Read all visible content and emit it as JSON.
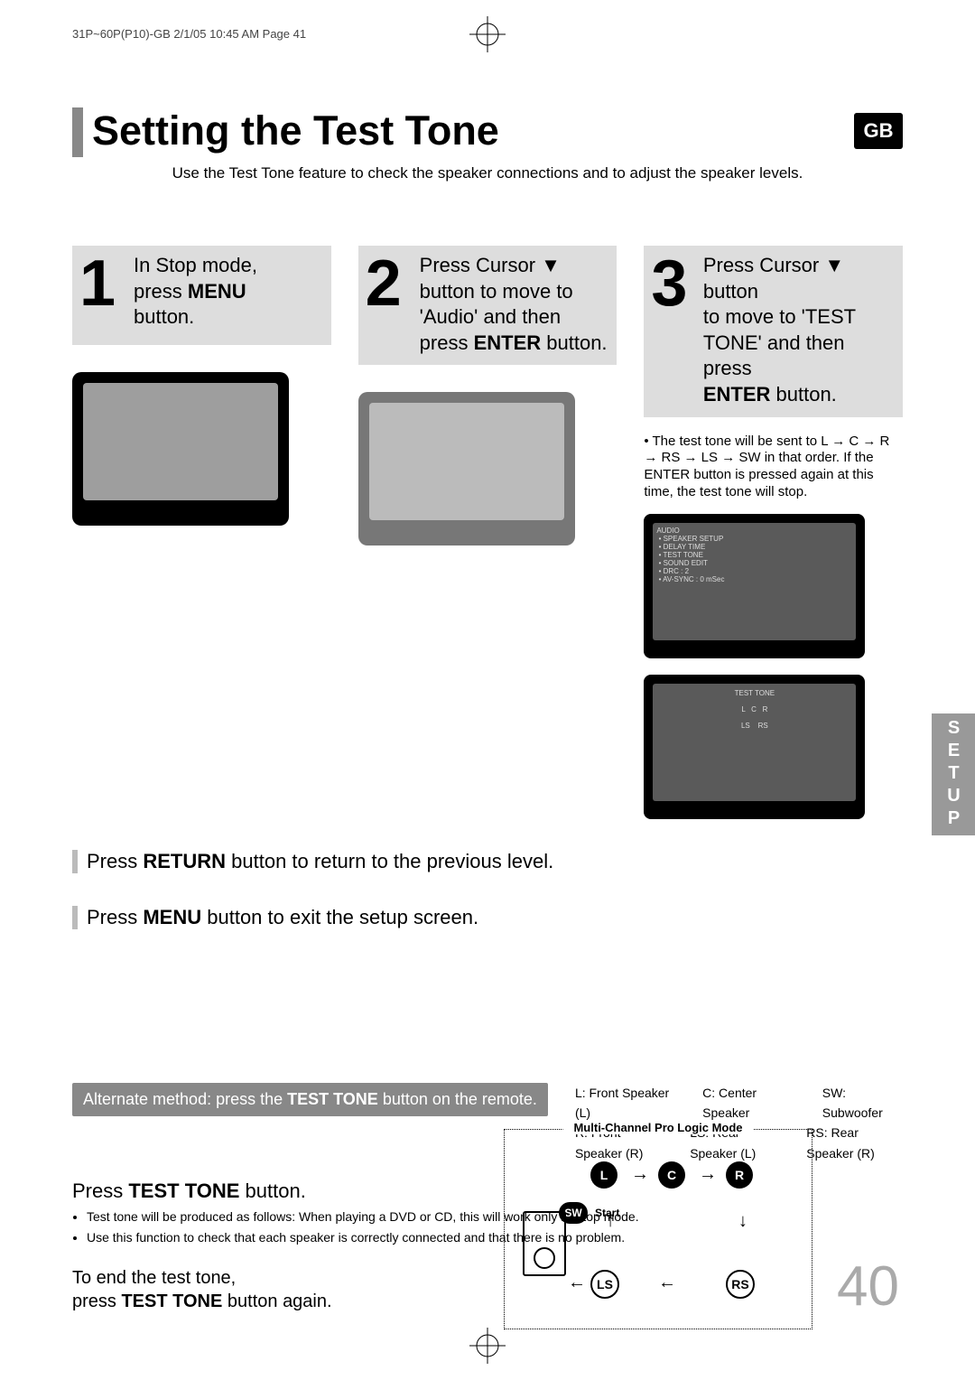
{
  "header_info": "31P~60P(P10)-GB  2/1/05 10:45 AM  Page 41",
  "title": "Setting the Test Tone",
  "gb_badge": "GB",
  "intro": "Use the Test Tone feature to check the speaker connections and to adjust the speaker levels.",
  "steps": {
    "s1": {
      "num": "1",
      "line1": "In Stop mode,",
      "line2a": "press ",
      "line2b": "MENU",
      "line3": "button."
    },
    "s2": {
      "num": "2",
      "line1": "Press Cursor  ▼",
      "line2": "button to move to",
      "line3": "'Audio' and then",
      "line4a": "press ",
      "line4b": "ENTER",
      "line4c": " button."
    },
    "s3": {
      "num": "3",
      "line1": "Press Cursor ▼ button",
      "line2": "to move to 'TEST",
      "line3": "TONE' and then press",
      "line4b": "ENTER",
      "line4c": " button."
    }
  },
  "s3_note": "• The test tone will be sent to L → C → R → RS → LS → SW in that order. If the ENTER button is pressed again at this time, the test tone will stop.",
  "return_line_a1": "Press ",
  "return_line_a2": "RETURN",
  "return_line_a3": " button to return to the previous level.",
  "menu_line_a1": "Press ",
  "menu_line_a2": "MENU",
  "menu_line_a3": " button to exit the setup screen.",
  "setup_tab": "SETUP",
  "alt_method_a": "Alternate method: press the ",
  "alt_method_b": "TEST TONE",
  "alt_method_c": " button on the remote.",
  "legend": {
    "r1": [
      "L: Front Speaker (L)",
      "C: Center Speaker",
      "SW: Subwoofer"
    ],
    "r2": [
      "R: Front Speaker (R)",
      "LS: Rear Speaker (L)",
      "RS: Rear Speaker (R)"
    ]
  },
  "press_tt_a": "Press ",
  "press_tt_b": "TEST TONE",
  "press_tt_c": " button.",
  "bullets": [
    "Test tone will be produced as follows: When playing a DVD or CD, this will work only in Stop mode.",
    "Use this function to check that each speaker is correctly connected and that there is no problem."
  ],
  "end_line1": "To end the test tone,",
  "end_line2a": "press ",
  "end_line2b": "TEST TONE",
  "end_line2c": " button again.",
  "diagram_title": "Multi-Channel Pro Logic Mode",
  "nodes": {
    "L": "L",
    "C": "C",
    "R": "R",
    "SW": "SW",
    "LS": "LS",
    "RS": "RS"
  },
  "start_label": "Start",
  "page_num": "40"
}
